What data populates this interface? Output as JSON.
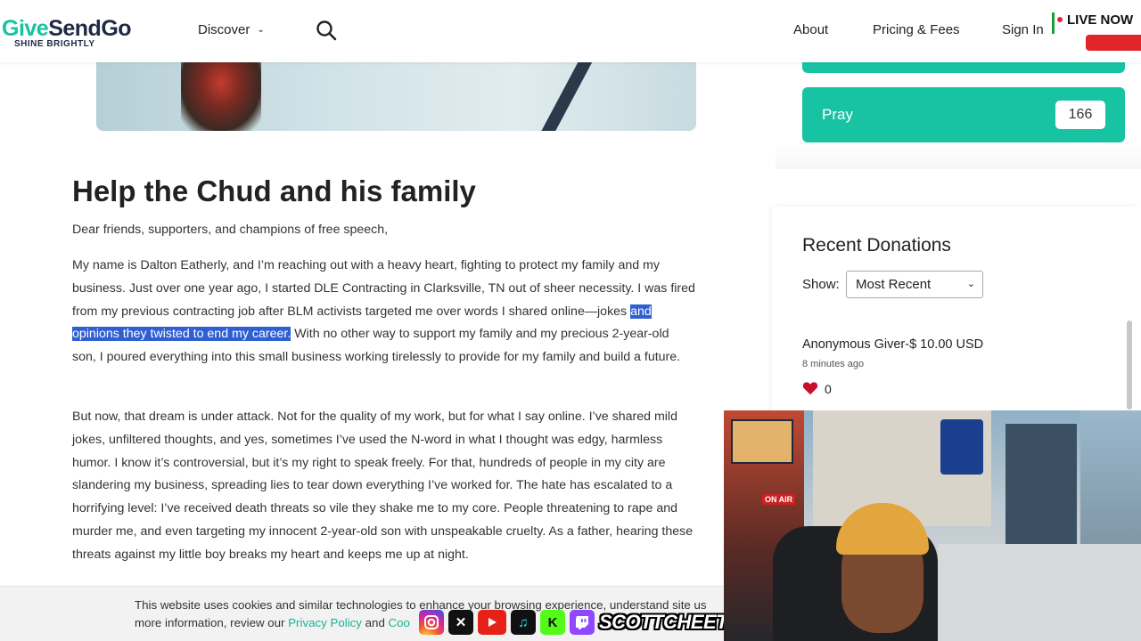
{
  "header": {
    "logo_name_a": "Give",
    "logo_name_b": "SendGo",
    "logo_tagline": "SHINE BRIGHTLY",
    "discover_label": "Discover",
    "nav": {
      "about": "About",
      "pricing": "Pricing & Fees",
      "signin": "Sign In"
    },
    "live_badge": "LIVE NOW"
  },
  "article": {
    "title": "Help the Chud and his family",
    "salutation": "Dear friends, supporters, and champions of free speech,",
    "p2_before": "My name is Dalton Eatherly, and I’m reaching out with a heavy heart, fighting to protect my family and my business. Just over one year ago, I started DLE Contracting in Clarksville, TN out of sheer necessity. I was fired from my previous contracting job after BLM activists targeted me over words I shared online—jokes ",
    "p2_highlight": "and opinions they twisted to end my career.",
    "p2_after": " With no other way to support my family and my precious 2-year-old son, I poured everything into this small business working tirelessly to provide for my family and build a future.",
    "p3": "But now, that dream is under attack. Not for the quality of my work, but for what I say online. I’ve shared mild jokes, unfiltered thoughts, and yes, sometimes I’ve used the N-word in what I thought was edgy, harmless humor. I know it’s controversial, but it’s my right to speak freely. For that, hundreds of people in my city are slandering my business, spreading lies to tear down everything I’ve worked for. The hate has escalated to a horrifying level: I’ve received death threats so vile they shake me to my core. People threatening to rape and murder me, and even targeting my innocent 2-year-old son with unspeakable cruelty. As a father, hearing these threats against my little boy breaks my heart and keeps me up at night."
  },
  "sidebar": {
    "pray_label": "Pray",
    "pray_count": "166",
    "donations_title": "Recent Donations",
    "show_label": "Show:",
    "show_selected": "Most Recent",
    "donation": {
      "donor": "Anonymous Giver-$ 10.00 USD",
      "time": "8 minutes ago",
      "likes": "0"
    }
  },
  "cookie": {
    "line1": "This website uses cookies and similar technologies to enhance your browsing experience, understand site us",
    "line2_prefix": "more information, review our ",
    "privacy_link": "Privacy Policy",
    "line2_mid": " and ",
    "cookie_link": "Coo"
  },
  "overlay": {
    "handle": "SCOTTCHEETOS",
    "onair": "ON AIR",
    "social_icons": [
      "instagram-icon",
      "x-icon",
      "youtube-icon",
      "tiktok-icon",
      "kick-icon",
      "twitch-icon"
    ]
  },
  "colors": {
    "brand_green": "#17c3a3",
    "highlight": "#2f5fd1",
    "live_red": "#e0262a"
  }
}
